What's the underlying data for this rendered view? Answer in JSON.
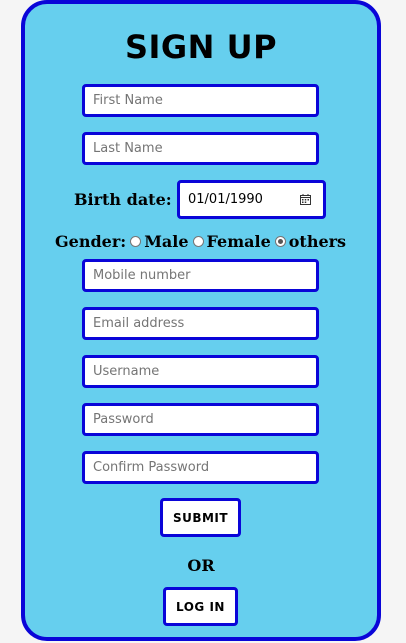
{
  "form": {
    "title": "SIGN UP",
    "first_name_placeholder": "First Name",
    "last_name_placeholder": "Last Name",
    "birth_label": "Birth date:",
    "birth_value": "01/01/1990",
    "gender_label": "Gender:",
    "gender_options": [
      "Male",
      "Female",
      "others"
    ],
    "gender_selected": "others",
    "mobile_placeholder": "Mobile number",
    "email_placeholder": "Email address",
    "username_placeholder": "Username",
    "password_placeholder": "Password",
    "confirm_password_placeholder": "Confirm Password",
    "submit_label": "SUBMIT",
    "or_text": "OR",
    "login_label": "LOG IN"
  },
  "colors": {
    "card_bg": "#66cfee",
    "border": "#0a05d8"
  },
  "icons": {
    "date_picker": "calendar-icon"
  }
}
